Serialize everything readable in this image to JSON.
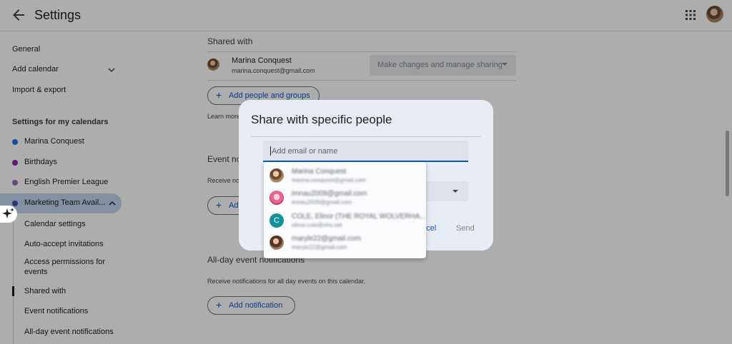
{
  "header": {
    "title": "Settings",
    "back_icon": "arrow-left-icon",
    "apps_icon": "apps-grid-icon"
  },
  "sidebar": {
    "general": "General",
    "add_calendar": "Add calendar",
    "import_export": "Import & export",
    "section_title": "Settings for my calendars",
    "calendars": [
      {
        "label": "Marina Conquest",
        "color": "#1a73e8"
      },
      {
        "label": "Birthdays",
        "color": "#8e24aa"
      },
      {
        "label": "English Premier League",
        "color": "#9e69af"
      },
      {
        "label": "Marketing Team Avail...",
        "color": "#7986cb"
      }
    ],
    "sub_items": [
      "Calendar settings",
      "Auto-accept invitations",
      "Access permissions for events",
      "Shared with",
      "Event notifications",
      "All-day event notifications"
    ]
  },
  "main": {
    "shared_with_title": "Shared with",
    "owner_name": "Marina Conquest",
    "owner_email": "marina.conquest@gmail.com",
    "permission_value": "Make changes and manage sharing",
    "add_people_label": "Add people and groups",
    "learn_more": "Learn more",
    "event_notifications_title": "Event no",
    "event_notifications_desc": "Receive noti",
    "add_event_btn": "Ad",
    "allday_title": "All-day event notifications",
    "allday_desc": "Receive notifications for all day events on this calendar.",
    "add_notification_label": "Add notification"
  },
  "dialog": {
    "title": "Share with specific people",
    "input_placeholder": "Add email or name",
    "cancel_label": "Cancel",
    "cancel_visible": "ncel",
    "send_label": "Send"
  },
  "suggestions": [
    {
      "name": "Marina Conquest",
      "email": "marina.conquest@gmail.com",
      "avatar": "photo"
    },
    {
      "name": "imnau2009@gmail.com",
      "email": "imnau2009@gmail.com",
      "avatar": "photo"
    },
    {
      "name": "COLE, Elinor (THE ROYAL WOLVERHA...",
      "email": "elinor.cole@nhs.net",
      "avatar": "C",
      "avatar_color": "#12939a"
    },
    {
      "name": "maryle22@gmail.com",
      "email": "maryle22@gmail.com",
      "avatar": "photo"
    }
  ]
}
